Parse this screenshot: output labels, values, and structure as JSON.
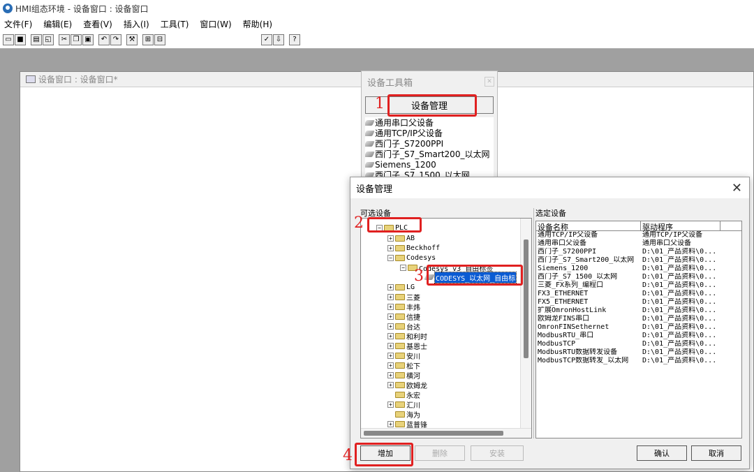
{
  "window": {
    "title": "HMI组态环境 - 设备窗口 : 设备窗口"
  },
  "menu": [
    "文件(F)",
    "编辑(E)",
    "查看(V)",
    "插入(I)",
    "工具(T)",
    "窗口(W)",
    "帮助(H)"
  ],
  "child_window": {
    "title": "设备窗口 : 设备窗口*"
  },
  "toolbox": {
    "title": "设备工具箱",
    "manage_button": "设备管理",
    "items": [
      "通用串口父设备",
      "通用TCP/IP父设备",
      "西门子_S7200PPI",
      "西门子_S7_Smart200_以太网",
      "Siemens_1200",
      "西门子_S7_1500_以太网"
    ]
  },
  "dialog": {
    "title": "设备管理",
    "available_label": "可选设备",
    "selected_label": "选定设备",
    "tree": {
      "root": "PLC",
      "nodes": [
        "AB",
        "Beckhoff",
        "Codesys",
        "Codesys_v3_自由标签",
        "CODESYS_以太网_自由标",
        "LG",
        "三菱",
        "丰炜",
        "信捷",
        "台达",
        "和利时",
        "基恩士",
        "安川",
        "松下",
        "横河",
        "欧姆龙",
        "永宏",
        "汇川",
        "海为",
        "蓝普锋"
      ]
    },
    "table": {
      "headers": [
        "设备名称",
        "驱动程序"
      ],
      "rows": [
        [
          "通用TCP/IP父设备",
          "通用TCP/IP父设备"
        ],
        [
          "通用串口父设备",
          "通用串口父设备"
        ],
        [
          "西门子_S7200PPI",
          "D:\\01_产品资料\\0..."
        ],
        [
          "西门子_S7_Smart200_以太网",
          "D:\\01_产品资料\\0..."
        ],
        [
          "Siemens_1200",
          "D:\\01_产品资料\\0..."
        ],
        [
          "西门子_S7_1500_以太网",
          "D:\\01_产品资料\\0..."
        ],
        [
          "三菱_FX系列_编程口",
          "D:\\01_产品资料\\0..."
        ],
        [
          "FX3_ETHERNET",
          "D:\\01_产品资料\\0..."
        ],
        [
          "FX5_ETHERNET",
          "D:\\01_产品资料\\0..."
        ],
        [
          "扩展OmronHostLink",
          "D:\\01_产品资料\\0..."
        ],
        [
          "欧姆龙FINS串口",
          "D:\\01_产品资料\\0..."
        ],
        [
          "OmronFINSethernet",
          "D:\\01_产品资料\\0..."
        ],
        [
          "ModbusRTU_串口",
          "D:\\01_产品资料\\0..."
        ],
        [
          "ModbusTCP",
          "D:\\01_产品资料\\0..."
        ],
        [
          "ModbusRTU数据转发设备",
          "D:\\01_产品资料\\0..."
        ],
        [
          "ModbusTCP数据转发_以太网",
          "D:\\01_产品资料\\0..."
        ]
      ]
    },
    "buttons": {
      "add": "增加",
      "delete": "删除",
      "install": "安装",
      "ok": "确认",
      "cancel": "取消"
    }
  },
  "steps": [
    "1",
    "2",
    "3",
    "4"
  ],
  "colors": {
    "highlight": "#e02020",
    "selection": "#0a5bd3",
    "workspace": "#a0a0a0"
  }
}
